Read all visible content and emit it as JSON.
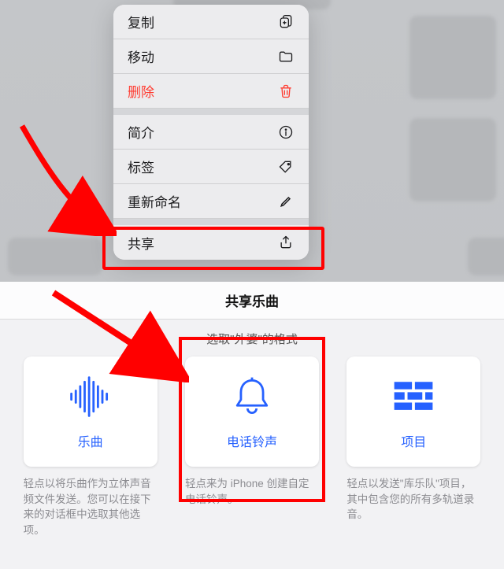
{
  "menu": {
    "copy": {
      "label": "复制"
    },
    "move": {
      "label": "移动"
    },
    "delete": {
      "label": "删除"
    },
    "info": {
      "label": "简介"
    },
    "tags": {
      "label": "标签"
    },
    "rename": {
      "label": "重新命名"
    },
    "share": {
      "label": "共享"
    }
  },
  "sheet": {
    "title": "共享乐曲",
    "subtitle": "选取\"外婆\"的格式"
  },
  "cards": {
    "song": {
      "label": "乐曲",
      "desc": "轻点以将乐曲作为立体声音频文件发送。您可以在接下来的对话框中选取其他选项。"
    },
    "ringtone": {
      "label": "电话铃声",
      "desc": "轻点来为 iPhone 创建自定电话铃声。"
    },
    "project": {
      "label": "项目",
      "desc": "轻点以发送\"库乐队\"项目，其中包含您的所有多轨道录音。"
    }
  }
}
